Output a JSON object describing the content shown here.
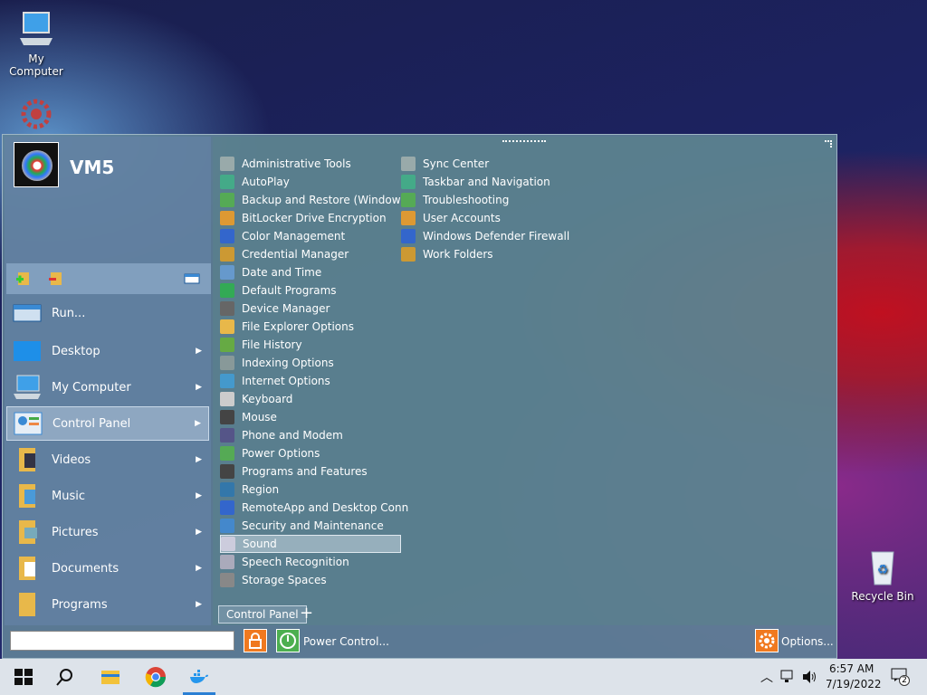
{
  "desktop": {
    "icons": [
      {
        "label": "My Computer",
        "icon": "computer-icon"
      },
      {
        "label": "",
        "icon": "settings-gear-icon"
      },
      {
        "label": "Recycle Bin",
        "icon": "recycle-bin-icon"
      }
    ]
  },
  "start_menu": {
    "username": "VM5",
    "left_items": [
      {
        "label": "Run...",
        "has_arrow": false
      },
      {
        "label": "Desktop",
        "has_arrow": true
      },
      {
        "label": "My Computer",
        "has_arrow": true
      },
      {
        "label": "Control Panel",
        "has_arrow": true,
        "selected": true
      },
      {
        "label": "Videos",
        "has_arrow": true
      },
      {
        "label": "Music",
        "has_arrow": true
      },
      {
        "label": "Pictures",
        "has_arrow": true
      },
      {
        "label": "Documents",
        "has_arrow": true
      },
      {
        "label": "Programs",
        "has_arrow": true
      }
    ],
    "control_panel_col1": [
      "Administrative Tools",
      "AutoPlay",
      "Backup and Restore (Windows",
      "BitLocker Drive Encryption",
      "Color Management",
      "Credential Manager",
      "Date and Time",
      "Default Programs",
      "Device Manager",
      "File Explorer Options",
      "File History",
      "Indexing Options",
      "Internet Options",
      "Keyboard",
      "Mouse",
      "Phone and Modem",
      "Power Options",
      "Programs and Features",
      "Region",
      "RemoteApp and Desktop Conn",
      "Security and Maintenance",
      "Sound",
      "Speech Recognition",
      "Storage Spaces"
    ],
    "control_panel_col2": [
      "Sync Center",
      "Taskbar and Navigation",
      "Troubleshooting",
      "User Accounts",
      "Windows Defender Firewall",
      "Work Folders"
    ],
    "selected_item": "Sound",
    "breadcrumb": "Control Panel",
    "power_label": "Power Control...",
    "options_label": "Options...",
    "search_value": ""
  },
  "taskbar": {
    "time": "6:57 AM",
    "date": "7/19/2022",
    "notification_count": "2"
  },
  "colors": {
    "accent_orange": "#f0791f",
    "power_green": "#4caf50"
  }
}
